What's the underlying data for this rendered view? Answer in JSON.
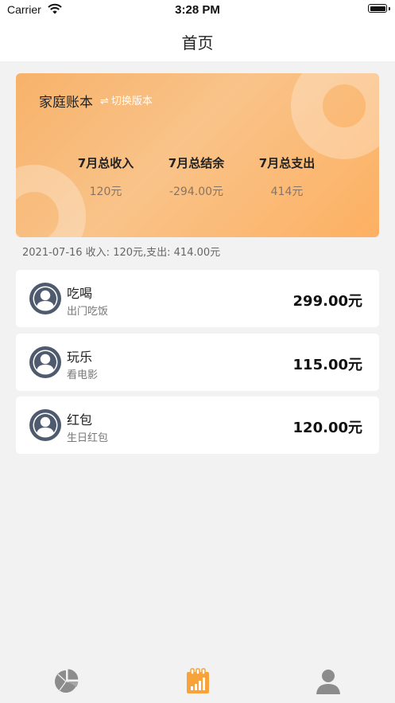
{
  "status_bar": {
    "carrier": "Carrier",
    "time": "3:28 PM"
  },
  "nav": {
    "title": "首页"
  },
  "summary": {
    "book_name": "家庭账本",
    "switch_icon": "⇌",
    "switch_label": "切换版本",
    "stats": [
      {
        "label": "7月总收入",
        "value": "120元"
      },
      {
        "label": "7月总结余",
        "value": "-294.00元"
      },
      {
        "label": "7月总支出",
        "value": "414元"
      }
    ]
  },
  "date_summary": "2021-07-16 收入: 120元,支出: 414.00元",
  "records": [
    {
      "title": "吃喝",
      "note": "出门吃饭",
      "amount": "299.00元"
    },
    {
      "title": "玩乐",
      "note": "看电影",
      "amount": "115.00元"
    },
    {
      "title": "红包",
      "note": "生日红包",
      "amount": "120.00元"
    }
  ],
  "tabbar": {
    "tabs": [
      {
        "icon": "pie-chart-icon"
      },
      {
        "icon": "calendar-chart-icon",
        "active": true
      },
      {
        "icon": "person-icon"
      }
    ]
  },
  "colors": {
    "accent": "#f7a23b",
    "card_start": "#f7b26a",
    "card_end": "#fdb062",
    "avatar": "#4e5a6e"
  }
}
